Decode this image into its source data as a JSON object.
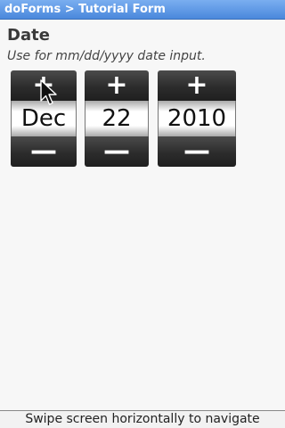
{
  "titlebar": {
    "title": "doForms > Tutorial Form"
  },
  "field": {
    "label": "Date",
    "hint": "Use for mm/dd/yyyy date input."
  },
  "date_picker": {
    "increment_glyph": "+",
    "decrement_glyph": "—",
    "month": "Dec",
    "day": "22",
    "year": "2010"
  },
  "footer": {
    "navigation_hint": "Swipe screen horizontally to navigate"
  },
  "colors": {
    "titlebar": "#4a88dc",
    "button": "#2c2c2c",
    "background": "#f7f7f7"
  },
  "icons": {
    "cursor": "mouse-pointer-icon"
  }
}
